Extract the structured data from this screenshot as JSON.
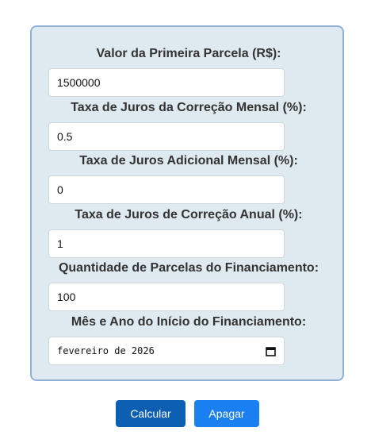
{
  "form": {
    "fields": [
      {
        "label": "Valor da Primeira Parcela (R$):",
        "value": "1500000"
      },
      {
        "label": "Taxa de Juros da Correção Mensal (%):",
        "value": "0.5"
      },
      {
        "label": "Taxa de Juros Adicional Mensal (%):",
        "value": "0"
      },
      {
        "label": "Taxa de Juros de Correção Anual (%):",
        "value": "1"
      },
      {
        "label": "Quantidade de Parcelas do Financiamento:",
        "value": "100"
      },
      {
        "label": "Mês e Ano do Início do Financiamento:",
        "value": "fevereiro de 2026"
      }
    ]
  },
  "buttons": {
    "calculate_label": "Calcular",
    "clear_label": "Apagar"
  },
  "icons": {
    "date_picker": "calendar-icon"
  },
  "colors": {
    "panel_background": "#dfeaf0",
    "panel_border": "#8fb1d6",
    "calculate_button": "#0d5fb3",
    "clear_button": "#1a7ff0"
  }
}
